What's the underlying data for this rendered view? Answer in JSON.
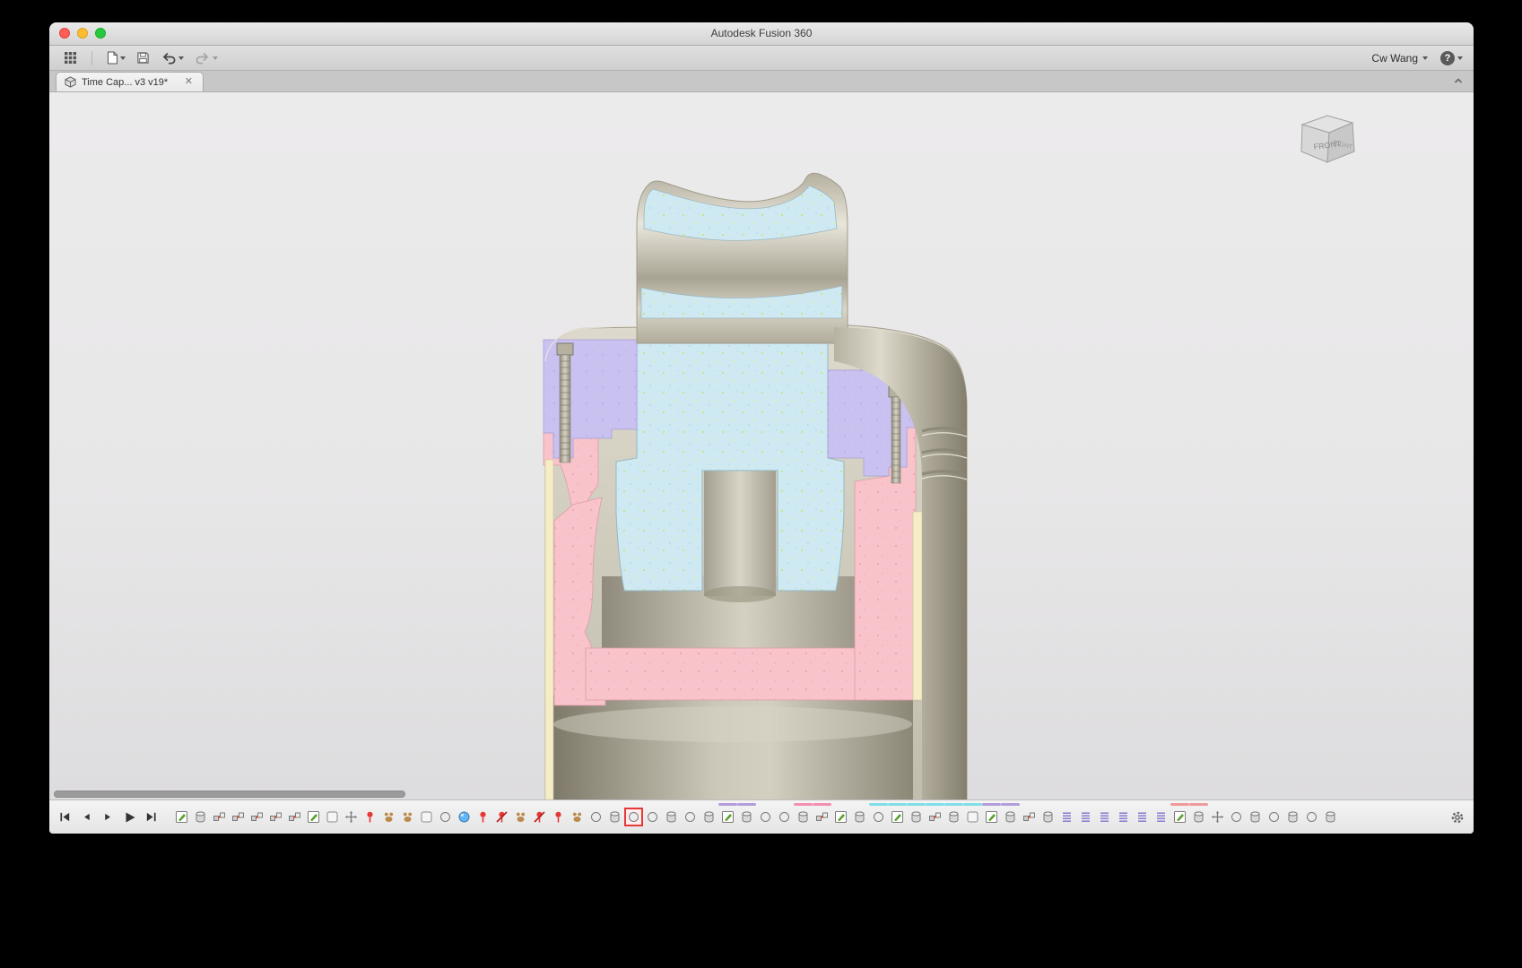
{
  "titlebar": {
    "title": "Autodesk Fusion 360"
  },
  "quick_toolbar": {
    "user_label": "Cw Wang",
    "help_label": "?"
  },
  "document_tab": {
    "label": "Time Cap... v3 v19*",
    "close_label": "✕"
  },
  "viewcube": {
    "front_label": "FRONT",
    "right_label": "RIGHT"
  },
  "colors": {
    "accent_highlight": "#e53935",
    "part_blue": "#cfe9f2",
    "part_pink": "#f8c3ca",
    "part_lavender": "#c9c1ef",
    "part_cream": "#f4edc6",
    "metal_light": "#dcd8ca",
    "metal_dark": "#8e897a"
  },
  "timeline": {
    "controls": [
      {
        "name": "skip-start"
      },
      {
        "name": "step-back"
      },
      {
        "name": "step-forward"
      },
      {
        "name": "play"
      },
      {
        "name": "skip-end"
      }
    ],
    "icons": [
      {
        "t": "sketch"
      },
      {
        "t": "solid"
      },
      {
        "t": "joint"
      },
      {
        "t": "joint"
      },
      {
        "t": "joint"
      },
      {
        "t": "joint"
      },
      {
        "t": "joint"
      },
      {
        "t": "sketch"
      },
      {
        "t": "box"
      },
      {
        "t": "move"
      },
      {
        "t": "pin"
      },
      {
        "t": "paw"
      },
      {
        "t": "paw"
      },
      {
        "t": "box"
      },
      {
        "t": "circle"
      },
      {
        "t": "sphere"
      },
      {
        "t": "pin"
      },
      {
        "t": "pinx"
      },
      {
        "t": "paw"
      },
      {
        "t": "pinx"
      },
      {
        "t": "pin"
      },
      {
        "t": "paw"
      },
      {
        "t": "circle"
      },
      {
        "t": "solid"
      },
      {
        "t": "circle",
        "h": true
      },
      {
        "t": "circle"
      },
      {
        "t": "solid"
      },
      {
        "t": "circle"
      },
      {
        "t": "solid"
      },
      {
        "t": "sketch",
        "b": "#b39ddb"
      },
      {
        "t": "solid",
        "b": "#b39ddb"
      },
      {
        "t": "circle"
      },
      {
        "t": "circle"
      },
      {
        "t": "solid",
        "b": "#f48fb1"
      },
      {
        "t": "joint",
        "b": "#f48fb1"
      },
      {
        "t": "sketch"
      },
      {
        "t": "solid"
      },
      {
        "t": "circle",
        "b": "#80deea"
      },
      {
        "t": "sketch",
        "b": "#80deea"
      },
      {
        "t": "solid",
        "b": "#80deea"
      },
      {
        "t": "joint",
        "b": "#80deea"
      },
      {
        "t": "solid",
        "b": "#80deea"
      },
      {
        "t": "box",
        "b": "#80deea"
      },
      {
        "t": "sketch",
        "b": "#b39ddb"
      },
      {
        "t": "solid",
        "b": "#b39ddb"
      },
      {
        "t": "joint"
      },
      {
        "t": "solid"
      },
      {
        "t": "spring"
      },
      {
        "t": "spring"
      },
      {
        "t": "spring"
      },
      {
        "t": "spring"
      },
      {
        "t": "spring"
      },
      {
        "t": "spring"
      },
      {
        "t": "sketch",
        "b": "#ef9a9a"
      },
      {
        "t": "solid",
        "b": "#ef9a9a"
      },
      {
        "t": "move"
      },
      {
        "t": "circle"
      },
      {
        "t": "solid"
      },
      {
        "t": "circle"
      },
      {
        "t": "solid"
      },
      {
        "t": "circle"
      },
      {
        "t": "solid"
      }
    ]
  }
}
